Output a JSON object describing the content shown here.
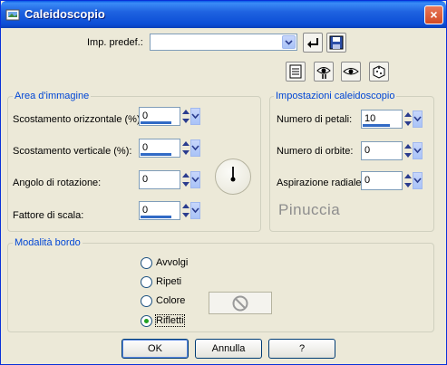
{
  "window": {
    "title": "Caleidoscopio",
    "close_label": "×"
  },
  "preset": {
    "label": "Imp. predef.:",
    "value": ""
  },
  "area_group": {
    "title": "Area d'immagine",
    "fields": [
      {
        "label": "Scostamento orizzontale (%):",
        "value": "0"
      },
      {
        "label": "Scostamento verticale (%):",
        "value": "0"
      },
      {
        "label": "Angolo di rotazione:",
        "value": "0"
      },
      {
        "label": "Fattore di scala:",
        "value": "0"
      }
    ]
  },
  "kaleido_group": {
    "title": "Impostazioni caleidoscopio",
    "fields": [
      {
        "label": "Numero di petali:",
        "value": "10"
      },
      {
        "label": "Numero di orbite:",
        "value": "0"
      },
      {
        "label": "Aspirazione radiale:",
        "value": "0"
      }
    ]
  },
  "watermark": "Pinuccia",
  "border_group": {
    "title": "Modalità bordo",
    "options": [
      "Avvolgi",
      "Ripeti",
      "Colore",
      "Rifletti"
    ],
    "selected": "Rifletti"
  },
  "buttons": {
    "ok": "OK",
    "cancel": "Annulla",
    "help": "?"
  },
  "colors": {
    "title_bar": "#0a5ae6",
    "group_title": "#0046d5",
    "spin_bar": "#316ac5",
    "dialog_bg": "#ece9d8"
  }
}
